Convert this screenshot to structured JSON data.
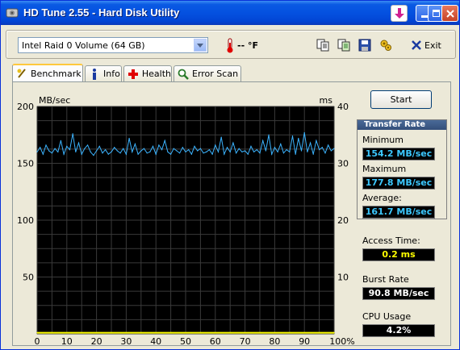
{
  "window": {
    "title": "HD Tune 2.55 - Hard Disk Utility",
    "title_color": "#0451e0"
  },
  "toolbar": {
    "drive": "Intel   Raid 0 Volume (64 GB)",
    "temperature": "-- °F",
    "exit_label": "Exit"
  },
  "tabs": [
    {
      "label": "Benchmark",
      "icon": "benchmark-icon",
      "active": true
    },
    {
      "label": "Info",
      "icon": "info-icon",
      "active": false
    },
    {
      "label": "Health",
      "icon": "health-icon",
      "active": false
    },
    {
      "label": "Error Scan",
      "icon": "error-scan-icon",
      "active": false
    }
  ],
  "benchmark": {
    "start_label": "Start",
    "transfer_rate": {
      "header": "Transfer Rate",
      "minimum_label": "Minimum",
      "minimum": "154.2 MB/sec",
      "maximum_label": "Maximum",
      "maximum": "177.8 MB/sec",
      "average_label": "Average:",
      "average": "161.7 MB/sec"
    },
    "access_time_label": "Access Time:",
    "access_time": "0.2 ms",
    "burst_rate_label": "Burst Rate",
    "burst_rate": "90.8 MB/sec",
    "cpu_usage_label": "CPU Usage",
    "cpu_usage": "4.2%"
  },
  "chart_data": {
    "type": "line",
    "ylabel_left": "MB/sec",
    "ylabel_right": "ms",
    "ylim_left": [
      0,
      200
    ],
    "ylim_right": [
      0,
      40
    ],
    "y_ticks_left": [
      "50",
      "100",
      "150",
      "200"
    ],
    "y_ticks_right": [
      "10",
      "20",
      "30",
      "40"
    ],
    "xlim": [
      0,
      100
    ],
    "x_ticks": [
      "0",
      "10",
      "20",
      "30",
      "40",
      "50",
      "60",
      "70",
      "80",
      "90",
      "100%"
    ],
    "grid": true,
    "colors": {
      "transfer": "#3cb4ff",
      "access": "#ffff00",
      "background": "#000000",
      "grid": "#3a3a3a"
    },
    "series": [
      {
        "key": "transfer",
        "unit": "MB/sec",
        "x": [
          0,
          1,
          2,
          3,
          4,
          5,
          6,
          7,
          8,
          9,
          10,
          11,
          12,
          13,
          14,
          15,
          16,
          17,
          18,
          19,
          20,
          21,
          22,
          23,
          24,
          25,
          26,
          27,
          28,
          29,
          30,
          31,
          32,
          33,
          34,
          35,
          36,
          37,
          38,
          39,
          40,
          41,
          42,
          43,
          44,
          45,
          46,
          47,
          48,
          49,
          50,
          51,
          52,
          53,
          54,
          55,
          56,
          57,
          58,
          59,
          60,
          61,
          62,
          63,
          64,
          65,
          66,
          67,
          68,
          69,
          70,
          71,
          72,
          73,
          74,
          75,
          76,
          77,
          78,
          79,
          80,
          81,
          82,
          83,
          84,
          85,
          86,
          87,
          88,
          89,
          90,
          91,
          92,
          93,
          94,
          95,
          96,
          97,
          98,
          99,
          100
        ],
        "y": [
          160,
          164,
          158,
          166,
          161,
          159,
          163,
          160,
          170,
          158,
          165,
          162,
          176,
          160,
          168,
          158,
          163,
          166,
          160,
          157,
          161,
          165,
          159,
          162,
          158,
          160,
          164,
          161,
          159,
          163,
          158,
          172,
          160,
          167,
          158,
          161,
          163,
          159,
          160,
          165,
          158,
          166,
          162,
          170,
          160,
          158,
          163,
          161,
          159,
          164,
          160,
          162,
          158,
          165,
          161,
          163,
          159,
          160,
          162,
          158,
          166,
          160,
          173,
          158,
          164,
          160,
          168,
          159,
          163,
          160,
          161,
          158,
          165,
          160,
          162,
          159,
          170,
          161,
          175,
          158,
          164,
          160,
          167,
          159,
          162,
          160,
          174,
          158,
          172,
          161,
          177,
          160,
          168,
          158,
          170,
          162,
          164,
          159,
          166,
          161,
          163
        ]
      },
      {
        "key": "access",
        "unit": "ms",
        "x": [
          0,
          10,
          20,
          30,
          40,
          50,
          60,
          70,
          80,
          90,
          100
        ],
        "y": [
          0.2,
          0.2,
          0.2,
          0.2,
          0.2,
          0.2,
          0.2,
          0.2,
          0.2,
          0.2,
          0.2
        ]
      }
    ]
  }
}
